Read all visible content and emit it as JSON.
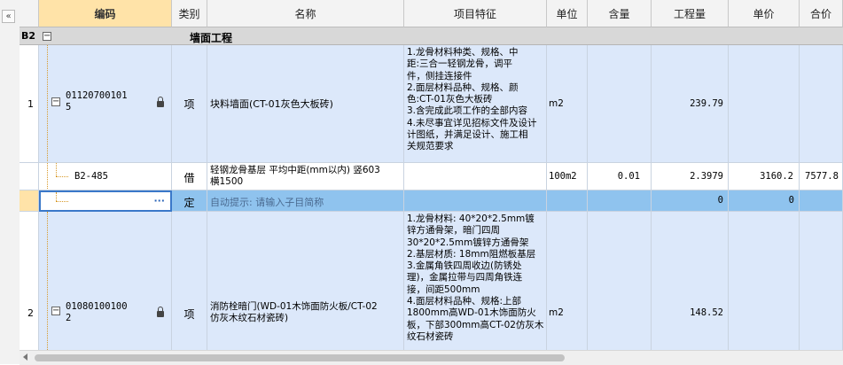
{
  "columns": {
    "code": "编码",
    "category": "类别",
    "name": "名称",
    "features": "项目特征",
    "unit": "单位",
    "content": "含量",
    "quantity": "工程量",
    "unit_price": "单价",
    "total": "合价"
  },
  "group": {
    "id": "B2",
    "expand_symbol": "−",
    "name": "墙面工程"
  },
  "rows": [
    {
      "index": "1",
      "code_line1": "01120700101",
      "code_line2": "5",
      "category": "项",
      "name": "块料墙面(CT-01灰色大板砖)",
      "features": "1.龙骨材料种类、规格、中\n距:三合一轻钢龙骨，调平\n件，侧挂连接件\n2.面层材料品种、规格、颜\n色:CT-01灰色大板砖\n3.含完成此项工作的全部内容\n4.未尽事宜详见招标文件及设计\n计图纸，并满足设计、施工相\n关规范要求",
      "unit": "m2",
      "quantity": "239.79"
    },
    {
      "code": "B2-485",
      "category": "借",
      "name_line1": "轻钢龙骨基层 平均中距(mm以内) 竖603",
      "name_line2": "横1500",
      "unit": "100m2",
      "content": "0.01",
      "quantity": "2.3979",
      "unit_price": "3160.2",
      "total": "7577.8"
    },
    {
      "code_ellipsis": "···",
      "category": "定",
      "name": "自动提示: 请输入子目简称",
      "quantity": "0",
      "unit_price": "0"
    },
    {
      "index": "2",
      "code_line1": "01080100100",
      "code_line2": "2",
      "category": "项",
      "name_line1": "消防栓暗门(WD-01木饰面防火板/CT-02",
      "name_line2": "仿灰木纹石材瓷砖)",
      "features": "1.龙骨材料: 40*20*2.5mm镀\n锌方通骨架，暗门四周\n30*20*2.5mm镀锌方通骨架\n2.基层材质: 18mm阻燃板基层\n3.金属角铁四周收边(防锈处\n理)，金属拉带与四周角铁连\n接，间距500mm\n4.面层材料品种、规格:上部\n1800mm高WD-01木饰面防火\n板，下部300mm高CT-02仿灰木\n纹石材瓷砖",
      "unit": "m2",
      "quantity": "148.52"
    }
  ],
  "sidebar": {
    "collapse_symbol": "«"
  }
}
